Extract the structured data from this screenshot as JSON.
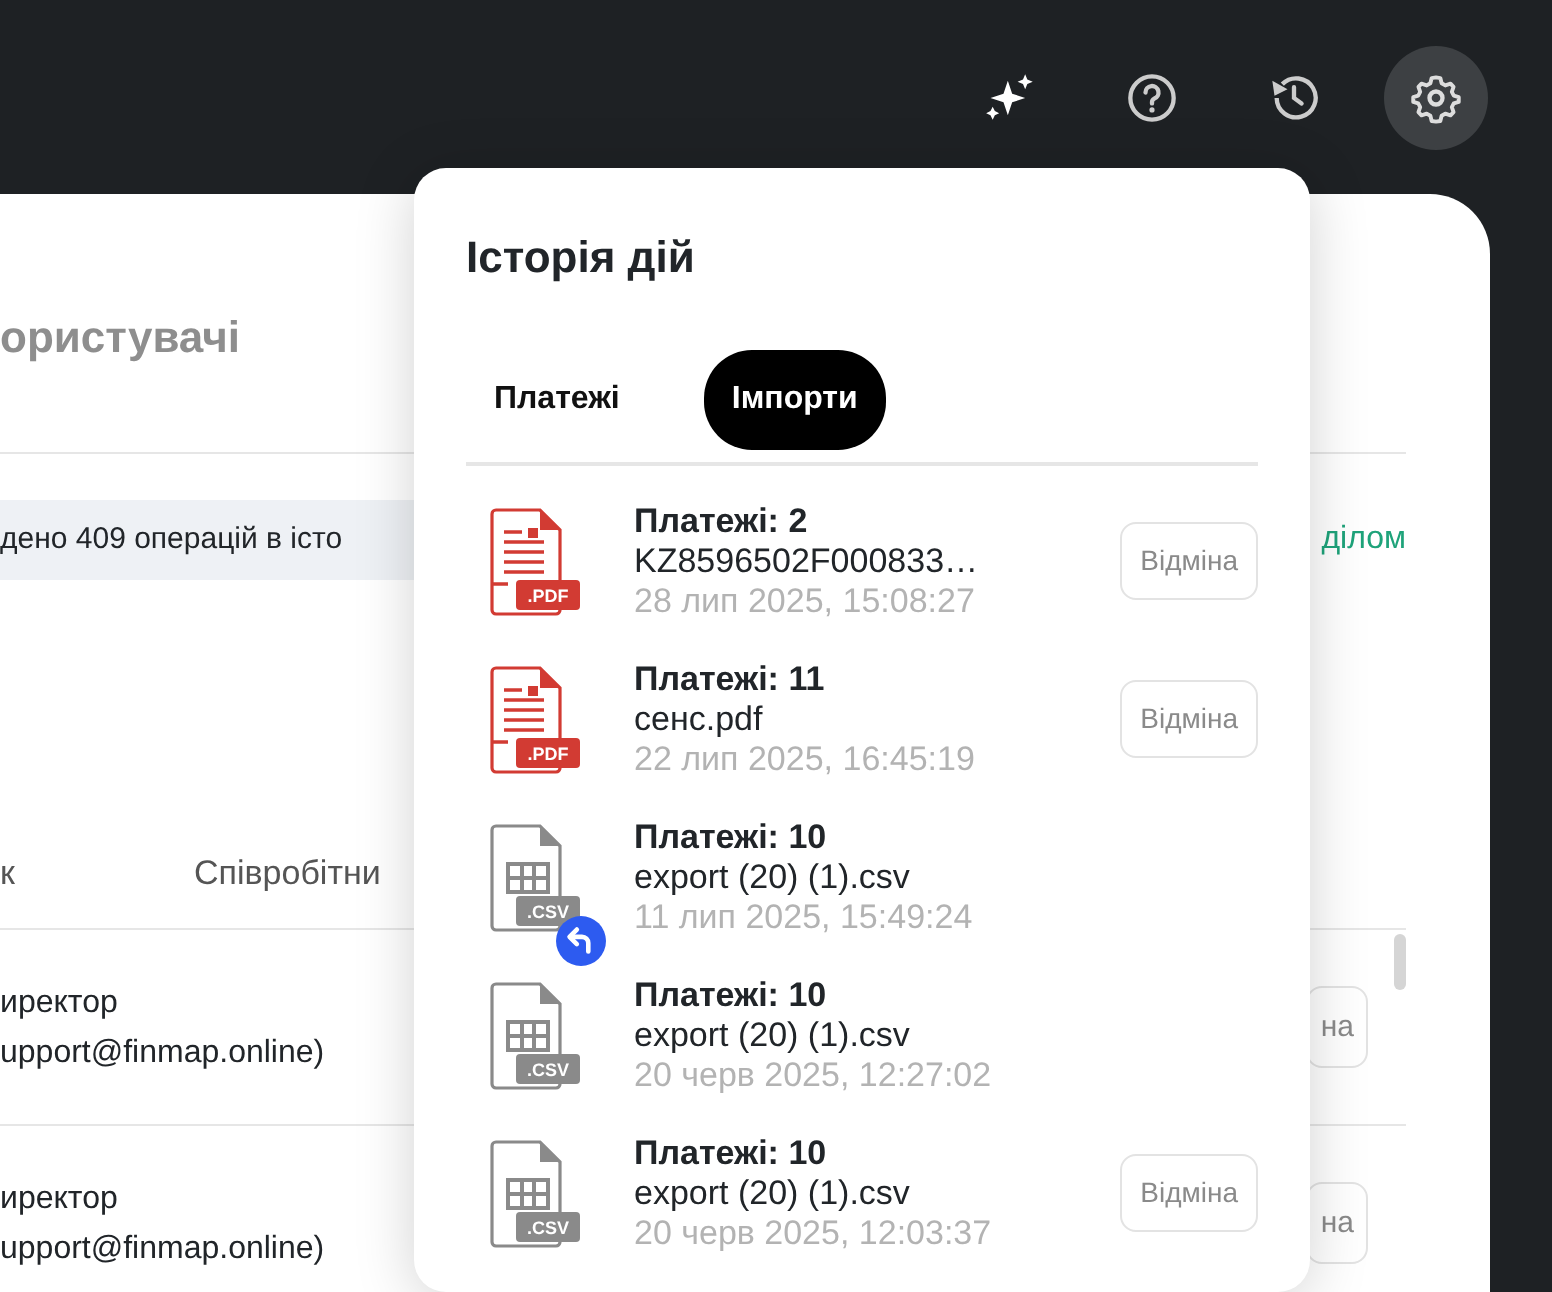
{
  "toolbar": {
    "buttons": [
      {
        "kind": "sparkle",
        "selected": false
      },
      {
        "kind": "help",
        "selected": false
      },
      {
        "kind": "history",
        "selected": false
      },
      {
        "kind": "settings",
        "selected": true
      }
    ]
  },
  "background_page": {
    "title": "ористувачі",
    "notice": "дено 409 операцій в істо",
    "link": "ділом",
    "columns": [
      "к",
      "Співробітни"
    ],
    "rows": [
      {
        "role": "иректор",
        "email": "upport@finmap.online)",
        "action": "на"
      },
      {
        "role": "иректор",
        "email": "upport@finmap.online)",
        "action": "на"
      }
    ]
  },
  "history_popup": {
    "title": "Історія дій",
    "tabs": [
      {
        "label": "Платежі",
        "selected": false
      },
      {
        "label": "Імпорти",
        "selected": true
      }
    ],
    "items": [
      {
        "kind": "pdf",
        "badge": ".PDF",
        "title": "Платежі: 2",
        "file": "KZ8596502F000833…",
        "date": "28 лип 2025, 15:08:27",
        "reverted": false,
        "action": "Відміна"
      },
      {
        "kind": "pdf",
        "badge": ".PDF",
        "title": "Платежі: 11",
        "file": "сенс.pdf",
        "date": "22 лип 2025, 16:45:19",
        "reverted": false,
        "action": "Відміна"
      },
      {
        "kind": "csv",
        "badge": ".CSV",
        "title": "Платежі: 10",
        "file": "export (20) (1).csv",
        "date": "11 лип 2025, 15:49:24",
        "reverted": true
      },
      {
        "kind": "csv",
        "badge": ".CSV",
        "title": "Платежі: 10",
        "file": "export (20) (1).csv",
        "date": "20 черв 2025, 12:27:02",
        "reverted": false
      },
      {
        "kind": "csv",
        "badge": ".CSV",
        "title": "Платежі: 10",
        "file": "export (20) (1).csv",
        "date": "20 черв 2025, 12:03:37",
        "reverted": false,
        "action": "Відміна"
      }
    ]
  }
}
